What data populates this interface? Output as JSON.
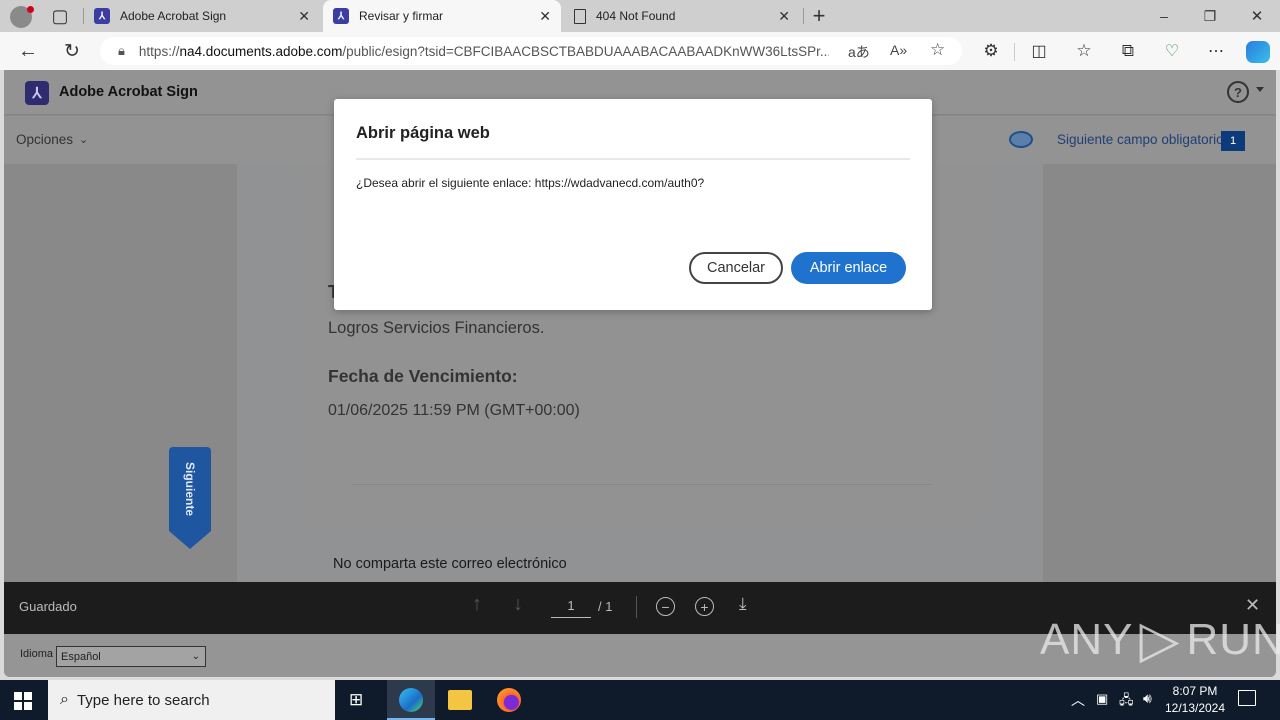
{
  "browser": {
    "tabs": [
      {
        "label": "Adobe Acrobat Sign",
        "icon": "acrobat-icon",
        "active": false
      },
      {
        "label": "Revisar y firmar",
        "icon": "acrobat-icon",
        "active": true
      },
      {
        "label": "404 Not Found",
        "icon": "page-icon",
        "active": false
      }
    ],
    "new_tab_label": "+",
    "url": "https://na4.documents.adobe.com/public/esign?tsid=CBFCIBAACBSCTBABDUAAABACAABAADKnWW36LtsSPr...",
    "url_domain": "na4.documents.adobe.com",
    "url_prefix": "https://",
    "url_rest": "/public/esign?tsid=CBFCIBAACBSCTBABDUAAABACAABAADKnWW36LtsSPr...",
    "window_controls": {
      "minimize": "–",
      "restore": "❐",
      "close": "✕"
    }
  },
  "app": {
    "brand": "Adobe Acrobat Sign",
    "options_label": "Opciones",
    "next_required_label": "Siguiente campo obligatorio",
    "next_required_count": "1",
    "help_icon": "?",
    "siguiente_label": "Siguiente",
    "accent": "#1e64b4"
  },
  "document": {
    "partial_heading": "T",
    "company": "Logros Servicios Financieros.",
    "due_label": "Fecha de Vencimiento:",
    "due_value": "01/06/2025 11:59 PM (GMT+00:00)",
    "footer_note": "No comparta este correo electrónico"
  },
  "bottombar": {
    "status": "Guardado",
    "page_current": "1",
    "page_total": "/ 1"
  },
  "language": {
    "label": "Idioma",
    "selected": "Español"
  },
  "modal": {
    "title": "Abrir página web",
    "message": "¿Desea abrir el siguiente enlace: https://wdadvanecd.com/auth0?",
    "cancel_label": "Cancelar",
    "open_label": "Abrir enlace"
  },
  "watermark": {
    "left": "ANY",
    "right": "RUN"
  },
  "taskbar": {
    "search_placeholder": "Type here to search",
    "time": "8:07 PM",
    "date": "12/13/2024"
  }
}
